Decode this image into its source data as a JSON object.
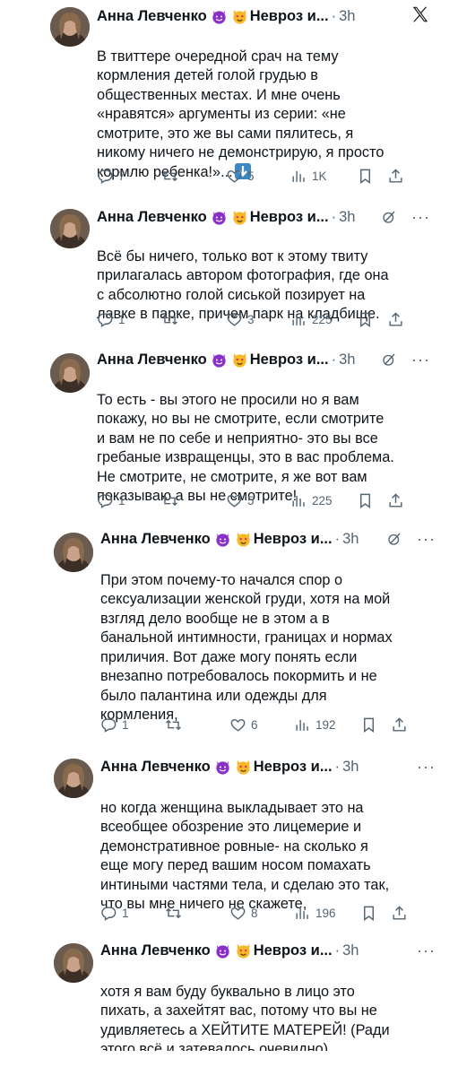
{
  "author": {
    "name": "Анна Левченко",
    "handle": "Невроз и...",
    "time": "3h"
  },
  "colors": {
    "text": "#0f1419",
    "muted": "#536471",
    "emoji_devil": "#8b2fc9",
    "emoji_cat": "#f7b928"
  },
  "icons": [
    "x-logo-icon",
    "grok-icon",
    "more-icon",
    "reply-icon",
    "retweet-icon",
    "like-icon",
    "views-icon",
    "bookmark-icon",
    "share-icon",
    "down-arrow-emoji"
  ],
  "tweets": [
    {
      "text": "В твиттере очередной срач на тему\nкормления детей голой грудью в\nобщественных местах. И мне очень\n«нравятся» аргументы из серии: «не\nсмотрите, это же вы сами пялитесь, я\nникому ничего не демонстрирую, я просто\nкормлю ребенка!»...",
      "replies": "7",
      "retweets": "",
      "likes": "5",
      "views": "1K"
    },
    {
      "text": "Всё бы ничего, только вот к этому твиту\nприлагалась автором фотография, где она\nс абсолютно голой сиськой позирует на\nлавке в парке, причем парк на кладбище.",
      "replies": "1",
      "retweets": "",
      "likes": "3",
      "views": "225"
    },
    {
      "text": "То есть - вы этого не просили но я вам\nпокажу, но вы не смотрите, если смотрите\nи вам не по себе и неприятно- это вы все\nгребаные извращенцы, это в вас проблема.\nНе смотрите, не смотрите, я же вот вам\nпоказываю а вы не смотрите!",
      "replies": "1",
      "retweets": "",
      "likes": "5",
      "views": "225"
    },
    {
      "text": "При этом почему-то начался спор о\nсексуализации женской груди, хотя на мой\nвзгляд дело вообще не в этом а в\nбанальной интимности, границах и нормах\nприличия. Вот даже могу понять если\nвнезапно потребовалось покормить и не\nбыло палантина или одежды для\nкормления,",
      "replies": "1",
      "retweets": "",
      "likes": "6",
      "views": "192"
    },
    {
      "text": "но когда женщина выкладывает это на\nвсеобщее обозрение это лицемерие и\nдемонстративное ровные- на сколько я\nеще могу перед вашим носом помахать\nинтиными частями тела, и сделаю это так,\nчто вы мне ничего не скажете,",
      "replies": "1",
      "retweets": "",
      "likes": "8",
      "views": "196"
    },
    {
      "text": "хотя я вам буду буквально в лицо это\nпихать, а захейтят вас, потому что вы не\nудивляетесь а ХЕЙТИТЕ МАТЕРЕЙ! (Ради\nэтого всё и затевалось очевидно)"
    }
  ]
}
